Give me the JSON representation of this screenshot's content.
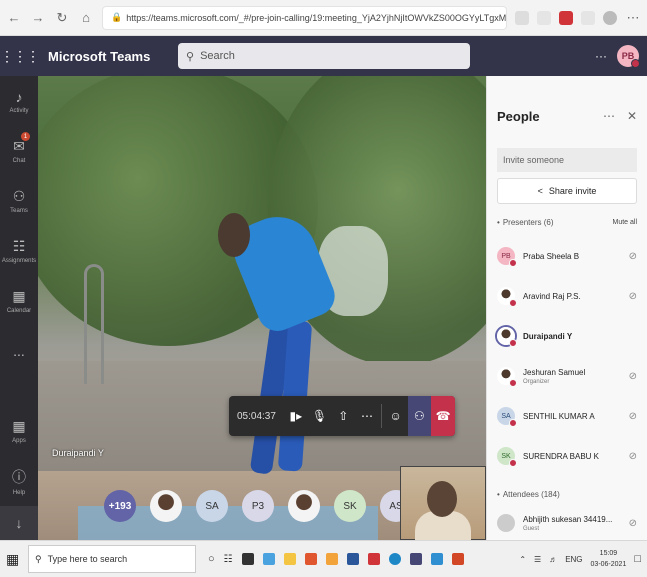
{
  "browser": {
    "url_host": "https://teams.microsoft.com/",
    "url_path": "_#/pre-join-calling/19:meeting_YjA2YjhNjItOWVkZS00OGYyLTgxMjYtYjY1NGMSZjRm..."
  },
  "header": {
    "app_title": "Microsoft Teams",
    "search_placeholder": "Search",
    "more": "···",
    "user_initials": "PB"
  },
  "rail": {
    "items": [
      {
        "label": "Activity",
        "icon": "bell-icon"
      },
      {
        "label": "Chat",
        "icon": "chat-icon",
        "badge": "1"
      },
      {
        "label": "Teams",
        "icon": "teams-icon"
      },
      {
        "label": "Assignments",
        "icon": "assignments-icon"
      },
      {
        "label": "Calendar",
        "icon": "calendar-icon"
      },
      {
        "label": "...",
        "icon": "more-icon"
      }
    ],
    "bottom": [
      {
        "label": "Apps",
        "icon": "apps-icon"
      },
      {
        "label": "Help",
        "icon": "help-icon"
      }
    ]
  },
  "stage": {
    "speaker_name": "Duraipandi Y",
    "call_time": "05:04:37"
  },
  "gallery": [
    {
      "label": "+193",
      "kind": "count"
    },
    {
      "label": "",
      "kind": "photo"
    },
    {
      "label": "SA",
      "kind": "initials",
      "color": "#c8d6e8"
    },
    {
      "label": "P3",
      "kind": "initials",
      "color": "#d8d8e8"
    },
    {
      "label": "",
      "kind": "photo"
    },
    {
      "label": "SK",
      "kind": "initials",
      "color": "#cfe6c9"
    },
    {
      "label": "AS",
      "kind": "initials",
      "color": "#d8d8e8"
    }
  ],
  "panel": {
    "title": "People",
    "invite_placeholder": "Invite someone",
    "share_label": "Share invite",
    "presenters_label": "Presenters (6)",
    "mute_all": "Mute all",
    "attendees_label": "Attendees (184)",
    "presenters": [
      {
        "name": "Praba Sheela B",
        "initials": "PB",
        "color": "#f4b6c2",
        "role": "",
        "bold": false
      },
      {
        "name": "Aravind Raj P.S.",
        "initials": "",
        "color": "",
        "role": "",
        "bold": false
      },
      {
        "name": "Duraipandi Y",
        "initials": "",
        "color": "",
        "role": "",
        "bold": true
      },
      {
        "name": "Jeshuran Samuel",
        "initials": "",
        "color": "",
        "role": "Organizer",
        "bold": false
      },
      {
        "name": "SENTHIL KUMAR A",
        "initials": "SA",
        "color": "#c8d6e8",
        "role": "",
        "bold": false
      },
      {
        "name": "SURENDRA BABU K",
        "initials": "SK",
        "color": "#cfe6c9",
        "role": "",
        "bold": false
      }
    ],
    "attendee": {
      "name": "Abhijith sukesan 34419...",
      "role": "Guest"
    }
  },
  "taskbar": {
    "search_placeholder": "Type here to search",
    "lang": "ENG",
    "time": "15:09",
    "date": "03-06-2021"
  }
}
